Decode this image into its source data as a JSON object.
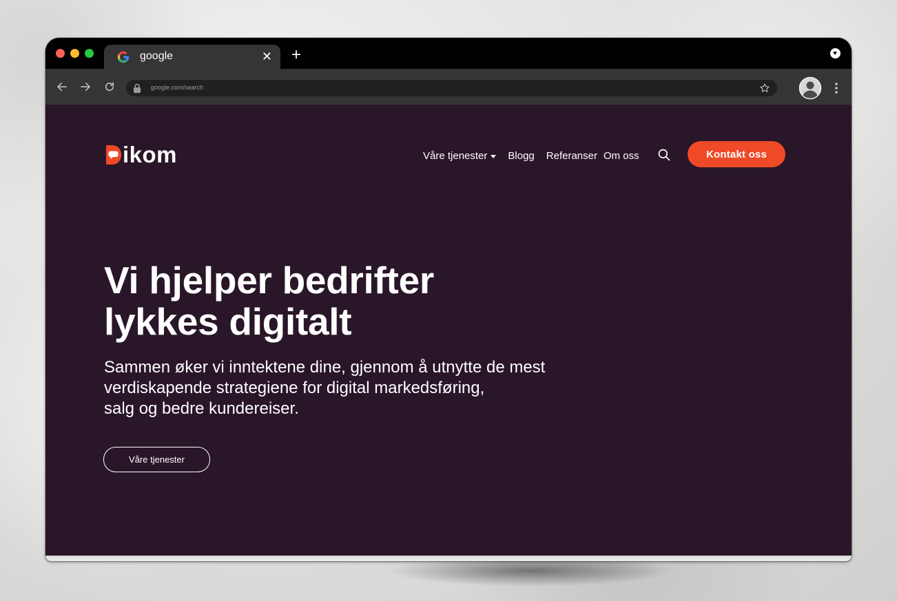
{
  "browser": {
    "tab": {
      "title": "google",
      "favicon": "google-g-icon",
      "close_glyph": "✕"
    },
    "new_tab_glyph": "+",
    "url": "google.com/search",
    "icons": [
      "back-arrow-icon",
      "forward-arrow-icon",
      "reload-icon",
      "lock-icon",
      "star-icon",
      "profile-icon",
      "kebab-menu-icon",
      "tab-dropdown-icon"
    ]
  },
  "site": {
    "logo_text": "ikom",
    "nav": {
      "items": [
        {
          "label": "Våre tjenester",
          "has_dropdown": true
        },
        {
          "label": "Blogg"
        },
        {
          "label": "Referanser"
        },
        {
          "label": "Om oss"
        }
      ],
      "search_icon": "search-icon",
      "cta_label": "Kontakt oss"
    },
    "hero": {
      "title_lines": [
        "Vi hjelper bedrifter",
        "lykkes digitalt"
      ],
      "subtitle_lines": [
        "Sammen øker vi inntektene dine, gjennom å utnytte de mest",
        "verdiskapende strategiene for digital markedsføring,",
        "salg og bedre kundereiser."
      ],
      "button_label": "Våre tjenester"
    }
  },
  "colors": {
    "page_background": "#2a1629",
    "accent": "#ef4a27",
    "tab_strip": "#000000",
    "toolbar": "#353535",
    "omnibox": "#202020",
    "text": "#ffffff"
  }
}
